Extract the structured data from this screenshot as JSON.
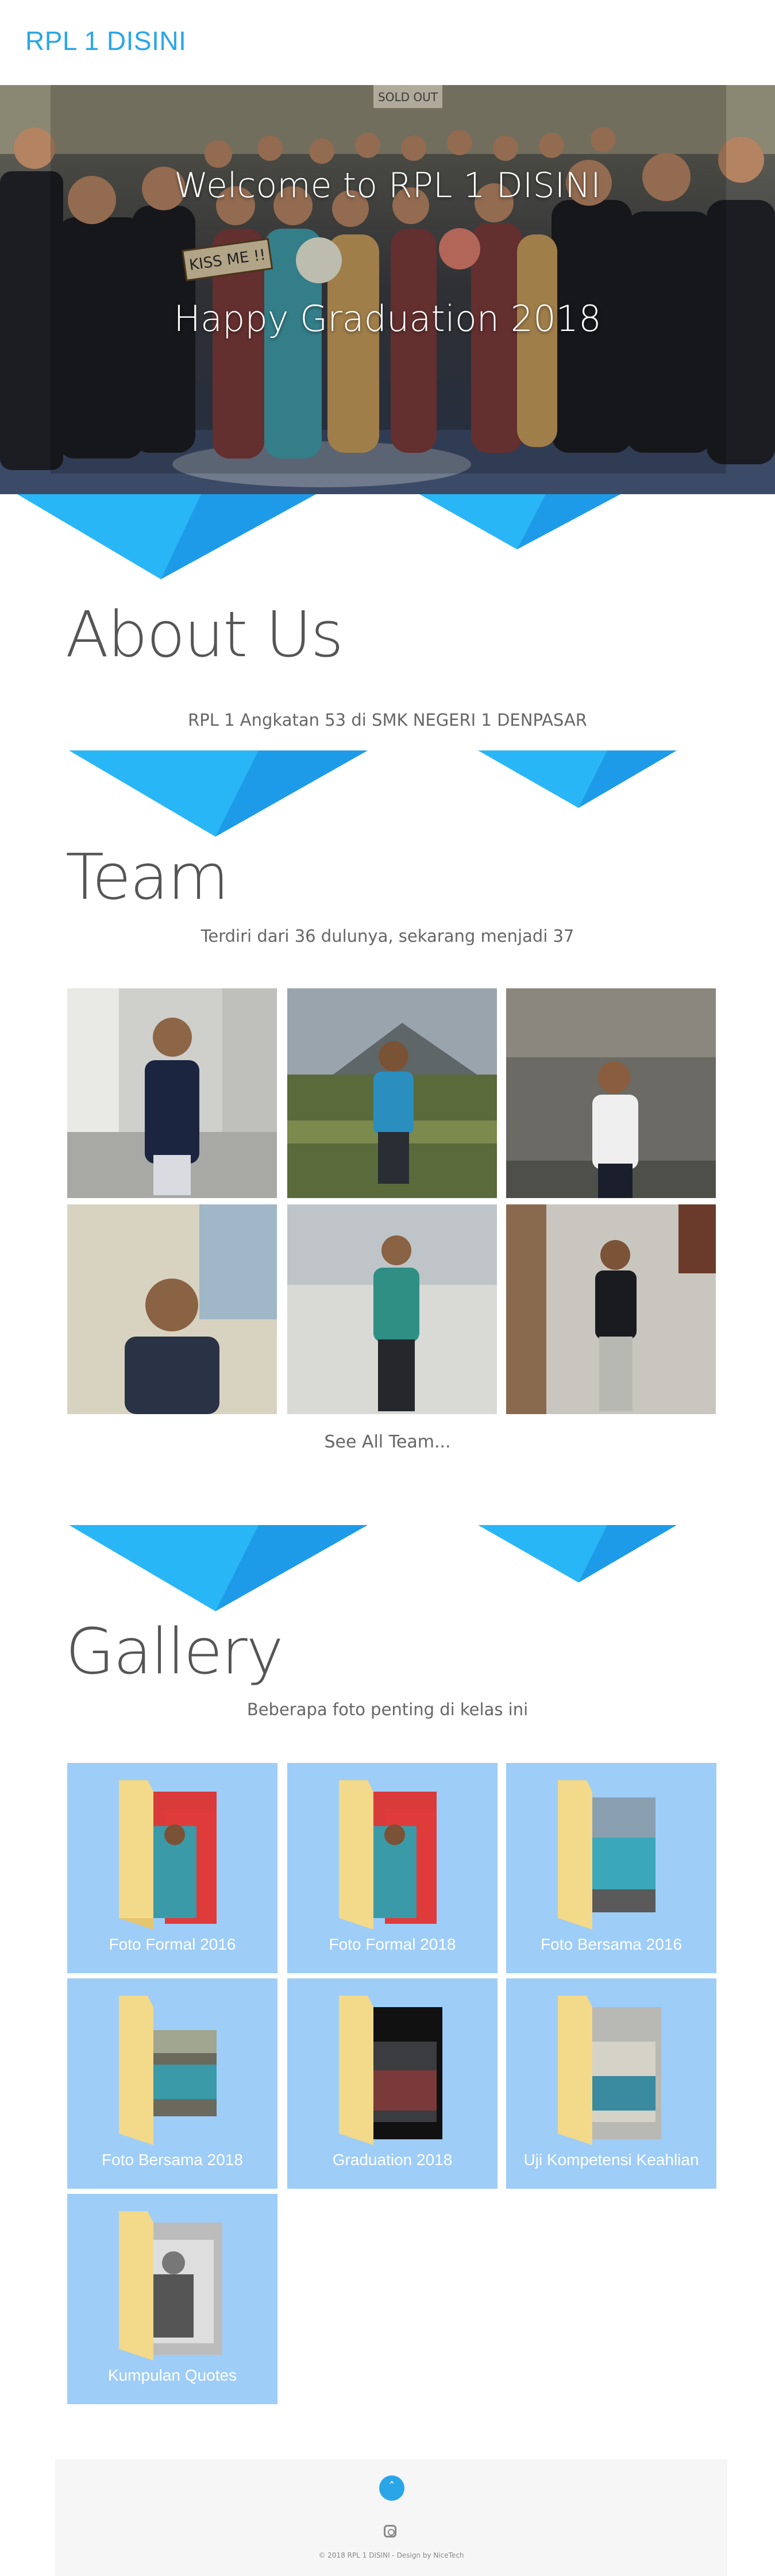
{
  "header": {
    "brand": "RPL 1 DISINI"
  },
  "hero": {
    "title": "Welcome to RPL 1 DISINI",
    "subtitle": "Happy Graduation 2018",
    "sign_text": "KISS ME !!",
    "soldout_text": "SOLD OUT"
  },
  "about": {
    "title": "About Us",
    "text": "RPL 1 Angkatan 53 di SMK NEGERI 1 DENPASAR"
  },
  "team": {
    "title": "Team",
    "text": "Terdiri dari 36 dulunya, sekarang menjadi 37",
    "see_all": "See All Team..."
  },
  "gallery": {
    "title": "Gallery",
    "text": "Beberapa foto penting di kelas ini",
    "items": [
      {
        "label": "Foto Formal 2016"
      },
      {
        "label": "Foto Formal 2018"
      },
      {
        "label": "Foto Bersama 2016"
      },
      {
        "label": "Foto Bersama 2018"
      },
      {
        "label": "Graduation 2018"
      },
      {
        "label": "Uji Kompetensi Keahlian"
      },
      {
        "label": "Kumpulan Quotes"
      }
    ]
  },
  "footer": {
    "copyright": "© 2018 RPL 1 DISINI - Design by NiceTech",
    "icons": [
      "chevron-up-icon",
      "instagram-icon"
    ]
  },
  "colors": {
    "accent": "#2aa6e8",
    "triangle_light": "#29b6f6",
    "triangle_dark": "#1e88e5",
    "tile_bg": "#9ecdf7"
  }
}
